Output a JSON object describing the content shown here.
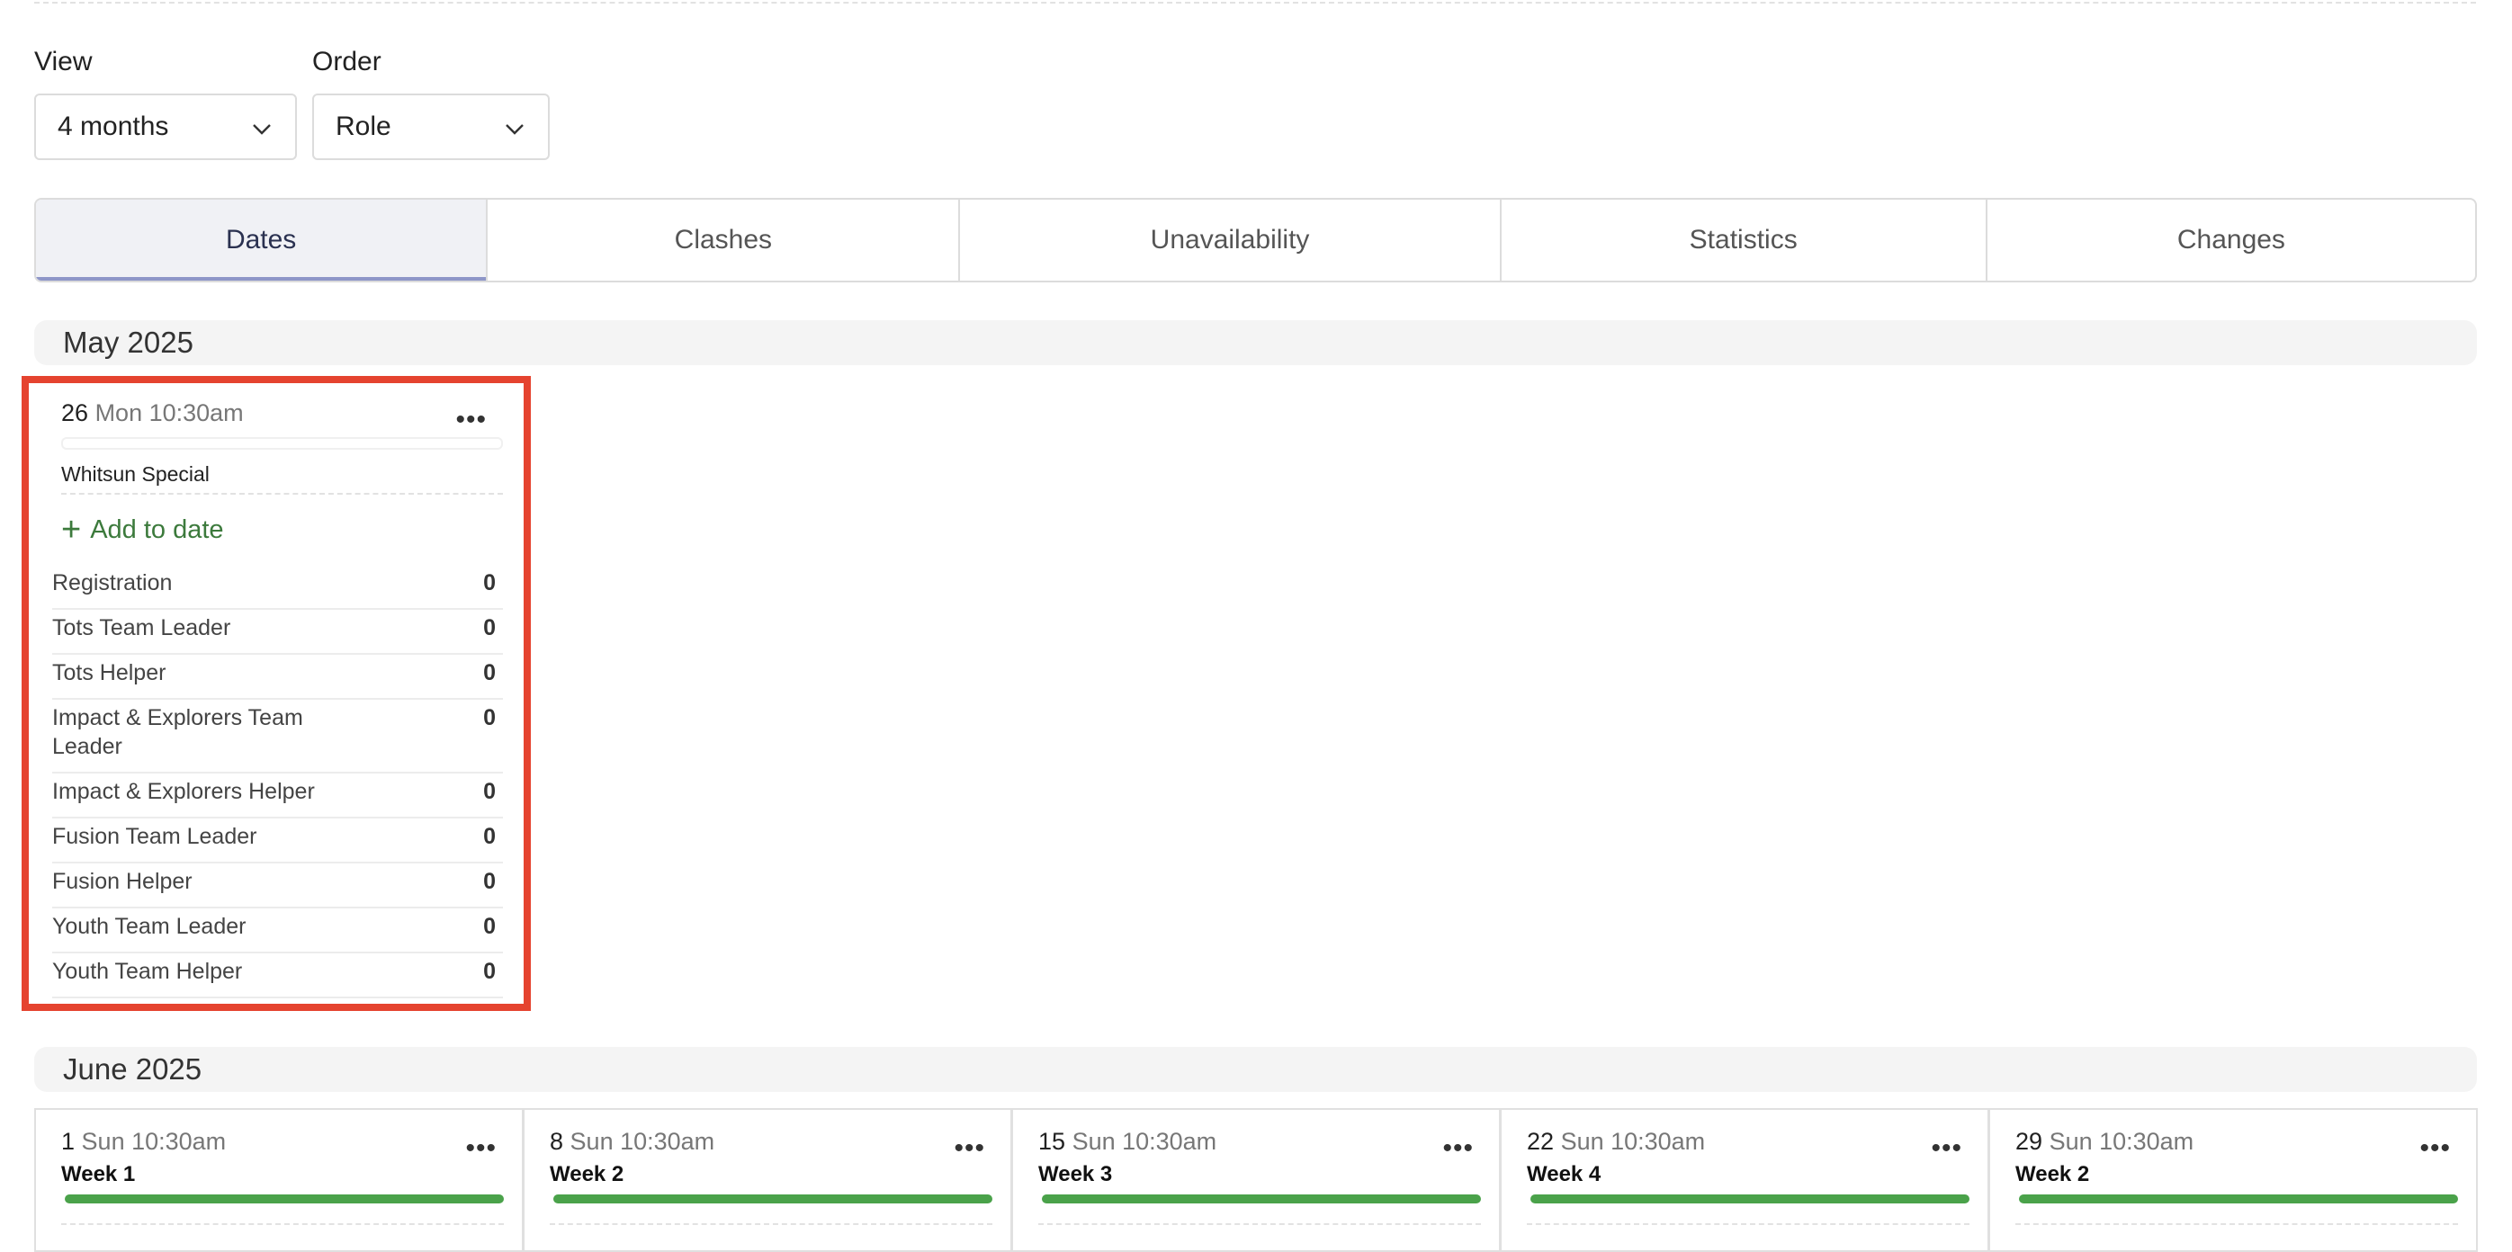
{
  "controls": {
    "view_label": "View",
    "view_value": "4 months",
    "order_label": "Order",
    "order_value": "Role"
  },
  "tabs": [
    {
      "label": "Dates",
      "active": true
    },
    {
      "label": "Clashes"
    },
    {
      "label": "Unavailability"
    },
    {
      "label": "Statistics"
    },
    {
      "label": "Changes"
    }
  ],
  "may": {
    "month": "May 2025",
    "card": {
      "day": "26",
      "weekday_time": "Mon 10:30am",
      "service": "Whitsun Special",
      "add_label": "Add to date",
      "roles": [
        {
          "name": "Registration",
          "count": "0"
        },
        {
          "name": "Tots Team Leader",
          "count": "0"
        },
        {
          "name": "Tots Helper",
          "count": "0"
        },
        {
          "name": "Impact & Explorers Team Leader",
          "count": "0"
        },
        {
          "name": "Impact & Explorers Helper",
          "count": "0"
        },
        {
          "name": "Fusion Team Leader",
          "count": "0"
        },
        {
          "name": "Fusion Helper",
          "count": "0"
        },
        {
          "name": "Youth Team Leader",
          "count": "0"
        },
        {
          "name": "Youth Team Helper",
          "count": "0"
        }
      ]
    }
  },
  "june": {
    "month": "June 2025",
    "cards": [
      {
        "day": "1",
        "weekday_time": "Sun 10:30am",
        "week": "Week 1"
      },
      {
        "day": "8",
        "weekday_time": "Sun 10:30am",
        "week": "Week 2"
      },
      {
        "day": "15",
        "weekday_time": "Sun 10:30am",
        "week": "Week 3"
      },
      {
        "day": "22",
        "weekday_time": "Sun 10:30am",
        "week": "Week 4"
      },
      {
        "day": "29",
        "weekday_time": "Sun 10:30am",
        "week": "Week 2"
      }
    ]
  },
  "colors": {
    "accent_green": "#4aa24a",
    "highlight_red": "#e5432f",
    "active_tab_underline": "#8e96c8"
  }
}
